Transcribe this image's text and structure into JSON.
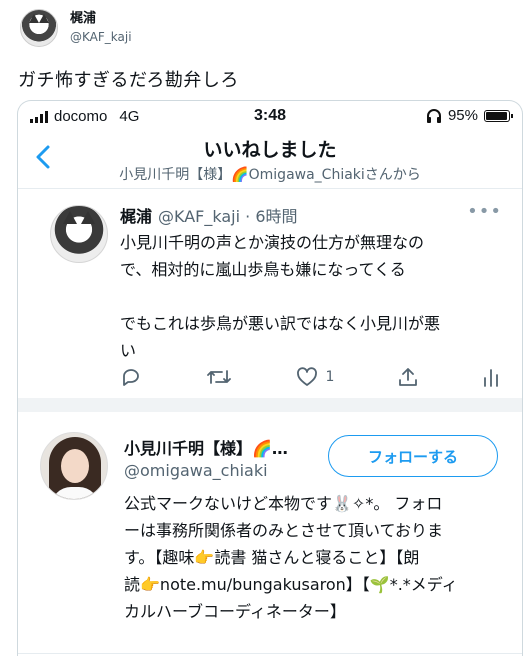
{
  "outer_tweet": {
    "author_name": "梶浦",
    "author_handle": "@KAF_kaji",
    "text": "ガチ怖すぎるだろ勘弁しろ"
  },
  "status_bar": {
    "carrier": "docomo",
    "network": "4G",
    "time": "3:48",
    "battery": "95%",
    "battery_level": 0.95
  },
  "nav": {
    "title": "いいねしました",
    "subtitle": "小見川千明【様】🌈Omigawa_Chiakiさんから"
  },
  "liked_tweet": {
    "author_name": "梶浦",
    "meta": "@KAF_kaji · 6時間",
    "lines": [
      "小見川千明の声とか演技の仕方が無理なの",
      "で、相対的に嵐山歩鳥も嫌になってくる",
      "でもこれは歩鳥が悪い訳ではなく小見川が悪",
      "い"
    ],
    "like_count": "1"
  },
  "profile": {
    "name": "小見川千明【様】🌈…",
    "handle": "@omigawa_chiaki",
    "follow_label": "フォローする",
    "bio_lines": [
      "公式マークないけど本物です🐰✧*。 フォロ",
      "ーは事務所関係者のみとさせて頂いておりま",
      "す。【趣味👉読書 猫さんと寝ること】【朗",
      "読👉note.mu/bungakusaron】【🌱*.*メディ",
      "カルハーブコーディネーター】"
    ]
  },
  "icons": {
    "back": "chevron-left-icon",
    "more": "more-dots-icon",
    "reply": "reply-icon",
    "retweet": "retweet-icon",
    "like": "heart-icon",
    "share": "share-icon",
    "stats": "stats-icon"
  },
  "colors": {
    "accent": "#1d9bf0",
    "secondary_text": "#536471"
  }
}
